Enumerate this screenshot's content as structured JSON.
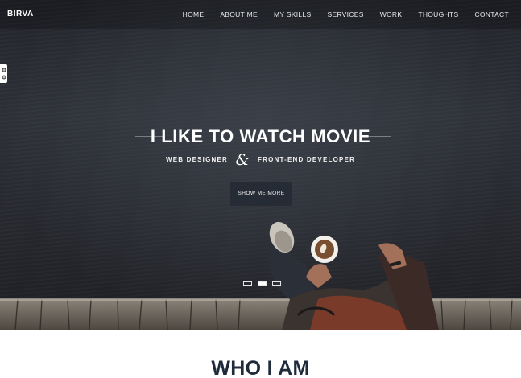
{
  "brand": "BIRVA",
  "nav": {
    "items": [
      "HOME",
      "ABOUT ME",
      "MY SKILLS",
      "SERVICES",
      "WORK",
      "THOUGHTS",
      "CONTACT"
    ]
  },
  "hero": {
    "headline": "I LIKE TO WATCH MOVIE",
    "role_left": "WEB DESIGNER",
    "amp": "&",
    "role_right": "FRONT-END DEVELOPER",
    "cta": "SHOW ME MORE",
    "slides_total": 3,
    "active_slide": 2
  },
  "about": {
    "title": "WHO I AM"
  },
  "icons": {
    "settings": "gear-icon"
  },
  "colors": {
    "hero_bg": "#2a2c32",
    "cta_bg": "#252c36",
    "heading_dark": "#1f2a3a"
  }
}
